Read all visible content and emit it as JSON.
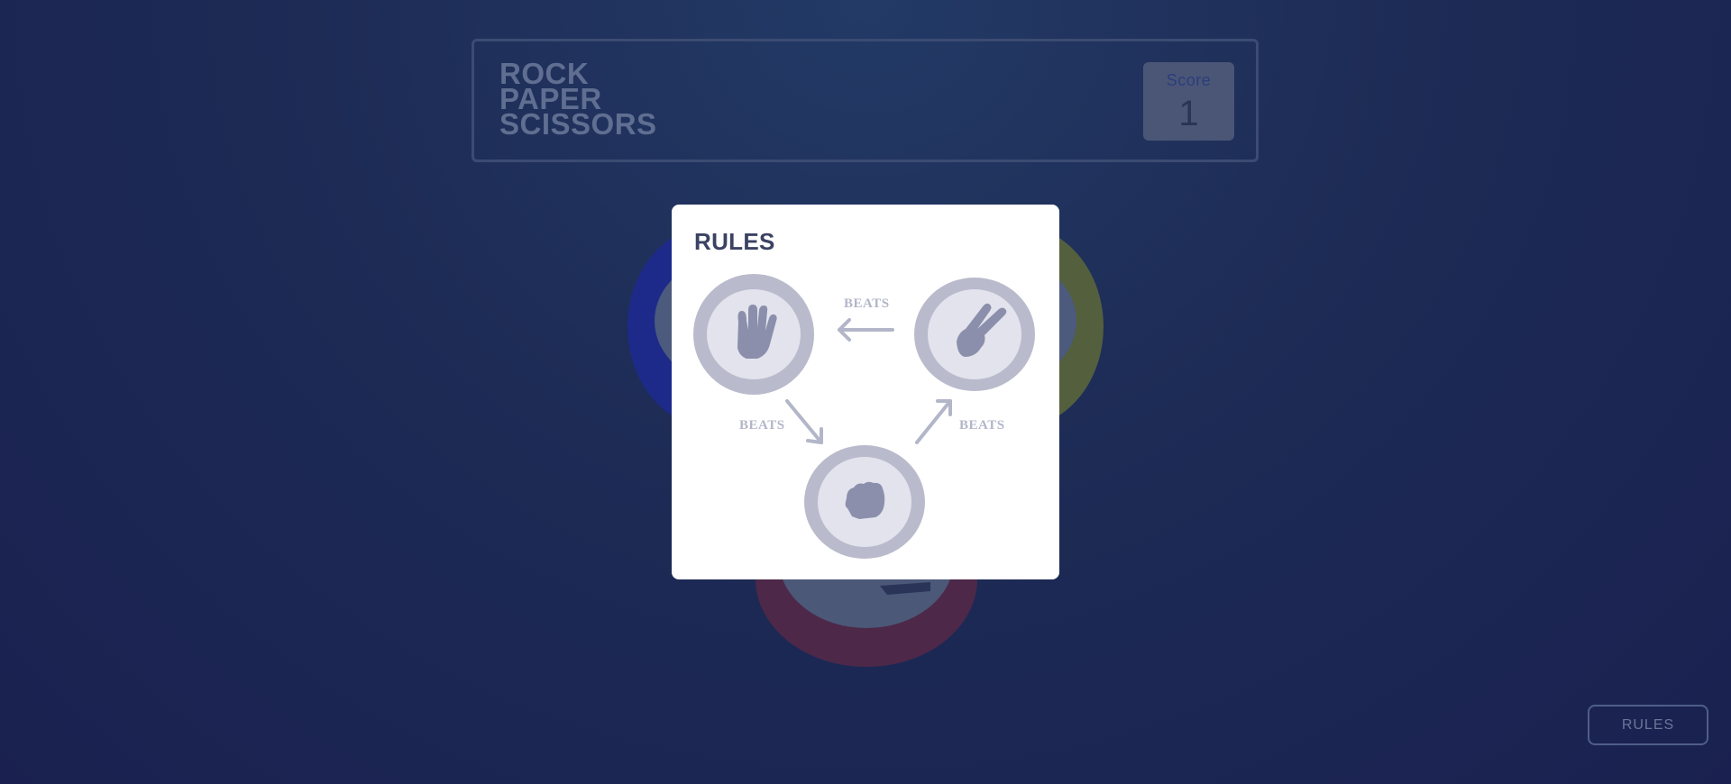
{
  "header": {
    "title_lines": [
      "ROCK",
      "PAPER",
      "SCISSORS"
    ],
    "score_label": "Score",
    "score_value": "1"
  },
  "modal": {
    "title": "RULES",
    "relations": [
      {
        "label": "BEATS",
        "winner": "scissors",
        "loser": "paper"
      },
      {
        "label": "BEATS",
        "winner": "paper",
        "loser": "rock"
      },
      {
        "label": "BEATS",
        "winner": "rock",
        "loser": "scissors"
      }
    ],
    "icons": [
      "paper-hand-icon",
      "scissors-hand-icon",
      "rock-fist-icon"
    ]
  },
  "rules_button": {
    "label": "RULES"
  },
  "colors": {
    "background": "#1d2b55",
    "modal_bg": "#ffffff",
    "modal_title": "#3b4262",
    "icon_ring": "#b9bbcc",
    "icon_inner": "#e2e3ed",
    "icon_glyph": "#8b8fab",
    "paper_chip": "#1e2a8a",
    "scissors_chip": "#545f3e",
    "rock_chip": "#4d2848"
  }
}
